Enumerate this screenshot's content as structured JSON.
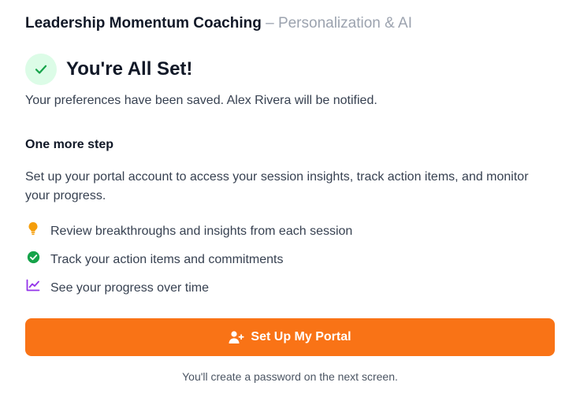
{
  "header": {
    "brand": "Leadership Momentum Coaching",
    "separator": " – ",
    "subtitle": "Personalization & AI"
  },
  "success": {
    "icon": "check-icon",
    "title": "You're All Set!",
    "message": "Your preferences have been saved. Alex Rivera will be notified."
  },
  "next_step": {
    "heading": "One more step",
    "description": "Set up your portal account to access your session insights, track action items, and monitor your progress.",
    "features": [
      {
        "icon": "lightbulb-icon",
        "label": "Review breakthroughs and insights from each session",
        "color": "#f59e0b"
      },
      {
        "icon": "check-circle-icon",
        "label": "Track your action items and commitments",
        "color": "#16a34a"
      },
      {
        "icon": "trend-chart-icon",
        "label": "See your progress over time",
        "color": "#9333ea"
      }
    ]
  },
  "cta": {
    "icon": "user-plus-icon",
    "label": "Set Up My Portal",
    "color": "#f97316"
  },
  "footnote": "You'll create a password on the next screen."
}
